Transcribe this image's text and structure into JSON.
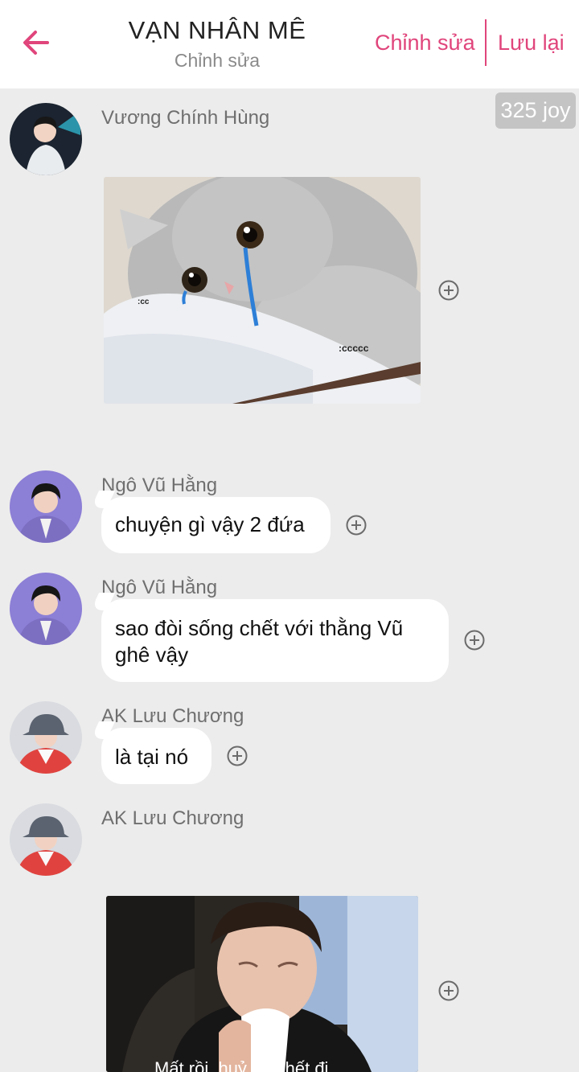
{
  "header": {
    "title": "VẠN NHÂN MÊ",
    "subtitle": "Chỉnh sửa",
    "edit_label": "Chỉnh sửa",
    "save_label": "Lưu lại",
    "accent_color": "#e0457b",
    "back_icon": "arrow-left-icon"
  },
  "joy_badge": "325 joy",
  "messages": [
    {
      "sender": "Vương Chính Hùng",
      "type": "image",
      "image": "crying-cat-meme",
      "image_text": [
        ":cc",
        ":ccccc"
      ]
    },
    {
      "sender": "Ngô Vũ Hằng",
      "type": "text",
      "text": "chuyện gì vậy 2 đứa"
    },
    {
      "sender": "Ngô Vũ Hằng",
      "type": "text",
      "text": "sao đòi sống chết với thằng Vũ ghê vậy"
    },
    {
      "sender": "AK Lưu Chương",
      "type": "text",
      "text": "là tại nó"
    },
    {
      "sender": "AK Lưu Chương",
      "type": "image",
      "image": "crying-boy-meme",
      "image_text": [
        "Mất rồi, huỷ diệt hết đi"
      ]
    }
  ],
  "add_icon": "plus-circle-icon"
}
